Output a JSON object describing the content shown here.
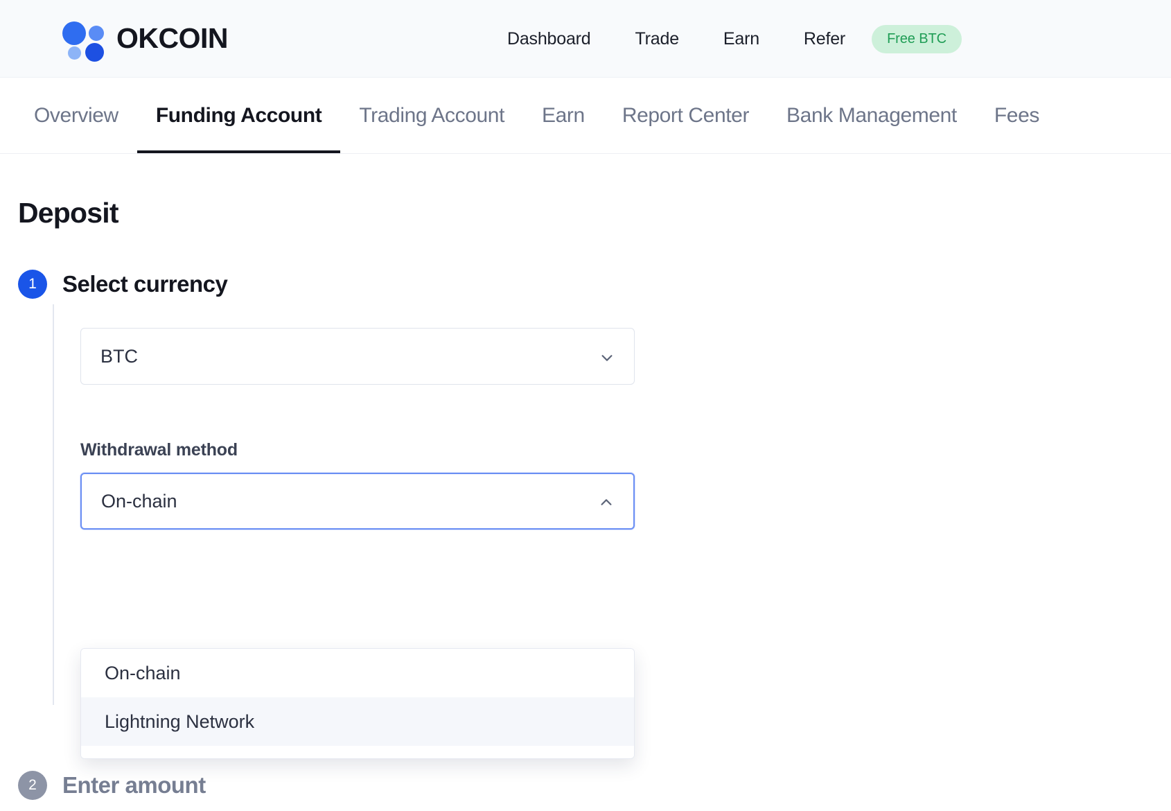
{
  "header": {
    "logo_text": "OKCOIN",
    "nav": [
      {
        "label": "Dashboard"
      },
      {
        "label": "Trade"
      },
      {
        "label": "Earn"
      },
      {
        "label": "Refer"
      }
    ],
    "badge": "Free BTC",
    "badge_bg": "#cdf0da",
    "badge_color": "#1f9d55"
  },
  "subnav": {
    "items": [
      {
        "label": "Overview",
        "active": false
      },
      {
        "label": "Funding Account",
        "active": true
      },
      {
        "label": "Trading Account",
        "active": false
      },
      {
        "label": "Earn",
        "active": false
      },
      {
        "label": "Report Center",
        "active": false
      },
      {
        "label": "Bank Management",
        "active": false
      },
      {
        "label": "Fees",
        "active": false
      }
    ]
  },
  "main": {
    "page_title": "Deposit",
    "steps": [
      {
        "number": "1",
        "title": "Select currency",
        "state": "active",
        "currency_value": "BTC",
        "method_label": "Withdrawal method",
        "method_value": "On-chain",
        "method_options": [
          {
            "label": "On-chain",
            "hovered": false
          },
          {
            "label": "Lightning Network",
            "hovered": true
          }
        ]
      },
      {
        "number": "2",
        "title": "Enter amount",
        "state": "inactive"
      }
    ]
  },
  "colors": {
    "accent_blue": "#1a55e8",
    "focus_blue": "#6b8ff4",
    "inactive_gray": "#8d94a6",
    "text_dark": "#14161f"
  }
}
